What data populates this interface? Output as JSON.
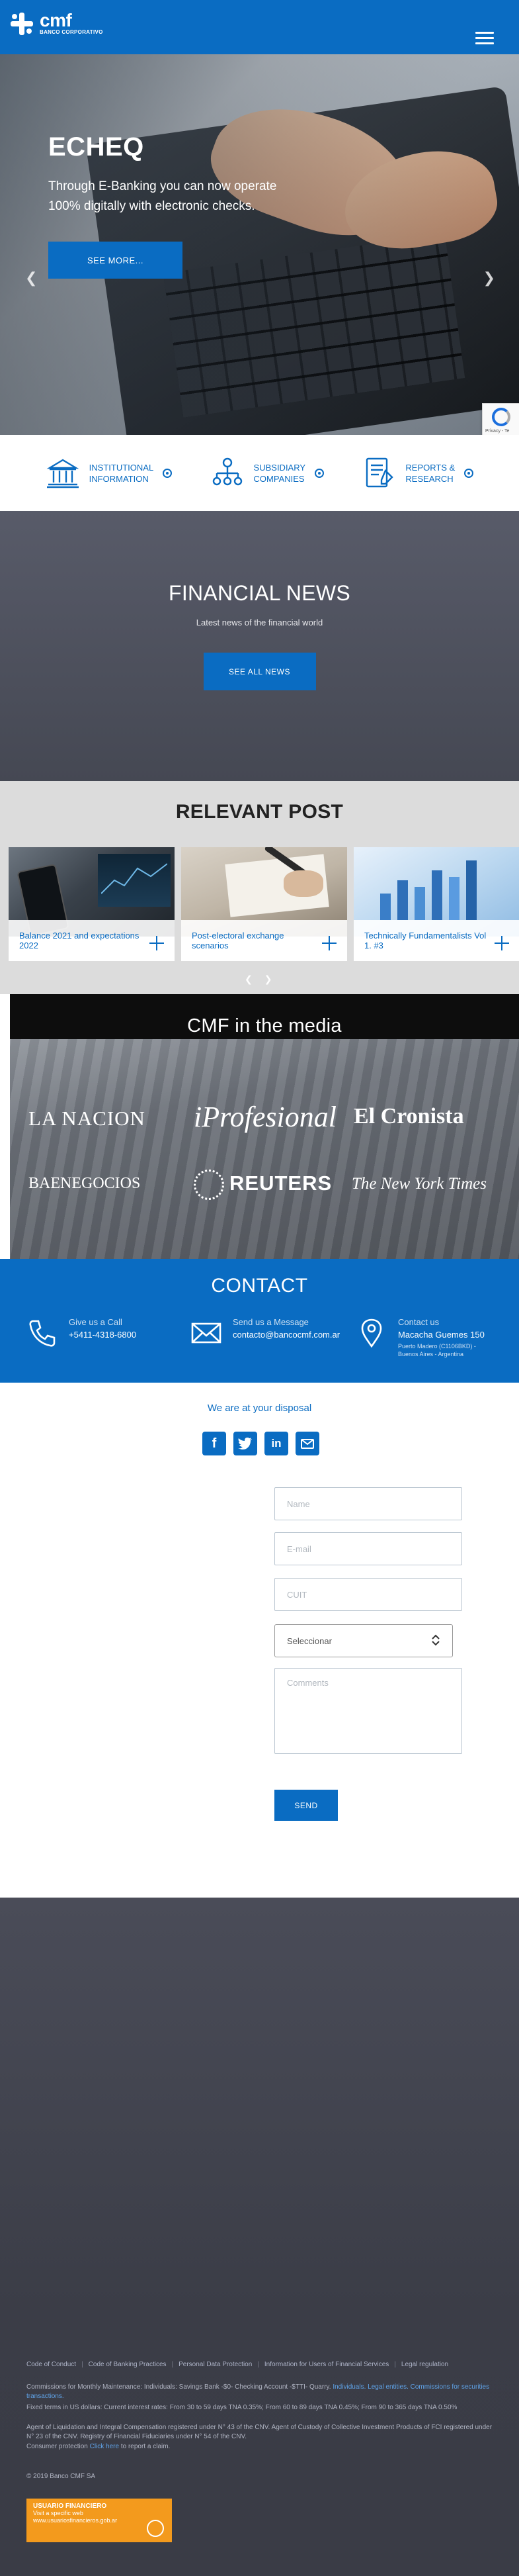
{
  "header": {
    "brand": "cmf",
    "brand_sub": "BANCO CORPORATIVO",
    "menu_icon": "hamburger-menu-icon"
  },
  "hero": {
    "title": "ECHEQ",
    "text": "Through E-Banking you can now operate 100% digitally with electronic checks.",
    "button": "SEE MORE...",
    "prev_icon": "chevron-left-icon",
    "next_icon": "chevron-right-icon"
  },
  "recaptcha": {
    "text": "Privacy - Te"
  },
  "quick_links": [
    {
      "label_1": "INSTITUTIONAL",
      "label_2": "INFORMATION",
      "icon": "bank-building-icon"
    },
    {
      "label_1": "SUBSIDIARY",
      "label_2": "COMPANIES",
      "icon": "org-chart-icon"
    },
    {
      "label_1": "REPORTS &",
      "label_2": "RESEARCH",
      "icon": "document-report-icon"
    }
  ],
  "financial_news": {
    "title": "FINANCIAL NEWS",
    "subtitle": "Latest news of the financial world",
    "button": "SEE ALL NEWS"
  },
  "relevant_post": {
    "title": "RELEVANT POST",
    "posts": [
      {
        "caption": "Balance 2021 and expectations 2022"
      },
      {
        "caption": "Post-electoral exchange scenarios"
      },
      {
        "caption": "Technically Fundamentalists Vol 1. #3"
      }
    ]
  },
  "media": {
    "title": "CMF in the media",
    "logos": [
      "LA NACION",
      "iProfesional",
      "El Cronista",
      "BAENEGOCIOS",
      "REUTERS",
      "The New York Times"
    ]
  },
  "contact": {
    "title": "CONTACT",
    "call_label": "Give us a Call",
    "call_value": "+5411-4318-6800",
    "message_label": "Send us a Message",
    "message_value": "contacto@bancocmf.com.ar",
    "visit_label": "Contact us",
    "visit_value": "Macacha Guemes 150",
    "visit_detail_1": "Puerto Madero (C1106BKD) -",
    "visit_detail_2": "Buenos Aires - Argentina"
  },
  "form": {
    "disposal": "We are at your disposal",
    "name_placeholder": "Name",
    "email_placeholder": "E-mail",
    "cuit_placeholder": "CUIT",
    "select_value": "Seleccionar",
    "comments_placeholder": "Comments",
    "send": "SEND"
  },
  "footer": {
    "links": [
      "Code of Conduct",
      "Code of Banking Practices",
      "Personal Data Protection",
      "Information for Users of Financial Services",
      "Legal regulation"
    ],
    "p1_a": "Commissions for Monthly Maintenance: Individuals: Savings Bank -$0- Checking Account -$TTI- Quarry. ",
    "p1_link": "Individuals. Legal entities. Commissions for securities transactions.",
    "p2": "Fixed terms in US dollars: Current interest rates: From 30 to 59 days TNA 0.35%; From 60 to 89 days TNA 0.45%; From 90 to 365 days TNA 0.50%",
    "p3": "Agent of Liquidation and Integral Compensation registered under N° 43 of the CNV. Agent of Custody of Collective Investment Products of FCI registered under N° 23 of the CNV. Registry of Financial Fiduciaries under N° 54 of the CNV.",
    "p4_a": "Consumer protection ",
    "p4_link": "Click here",
    "p4_b": " to report a claim.",
    "copyright": "© 2019 Banco CMF SA",
    "badge_title": "USUARIO FINANCIERO",
    "badge_line_1": "Visit a specific web",
    "badge_line_2": "www.usuariosfinancieros.gob.ar"
  }
}
